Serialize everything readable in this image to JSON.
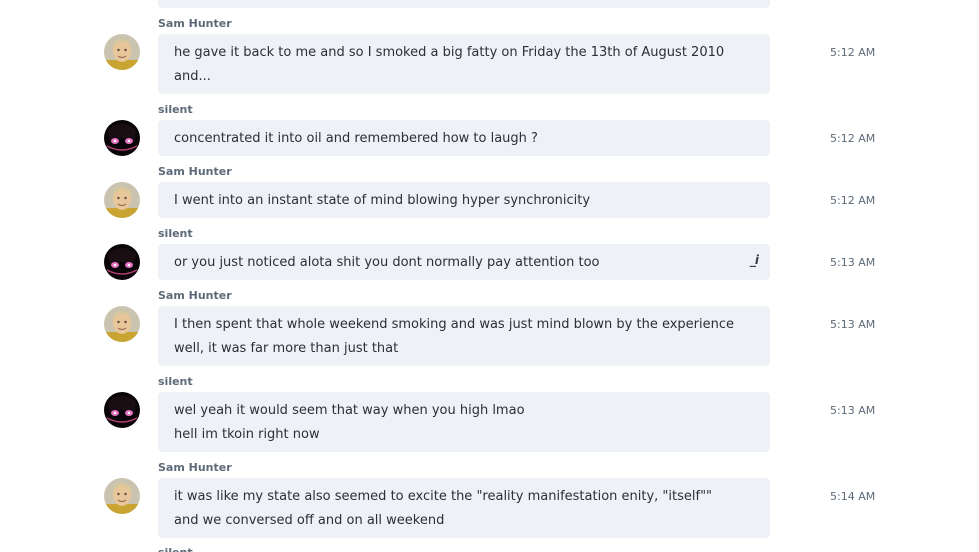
{
  "colors": {
    "bubble_bg": "#eef1f5",
    "sender_text": "#5d6a78",
    "message_text": "#2c2f33",
    "time_text": "#5d6a78"
  },
  "messages": [
    {
      "sender": "Sam Hunter",
      "avatar": "sam-avatar",
      "lines": [
        "he gave it back to me and so I smoked a big fatty on Friday the 13th of August 2010",
        "and..."
      ],
      "time": "5:12 AM"
    },
    {
      "sender": "silent",
      "avatar": "silent-avatar",
      "lines": [
        "concentrated it into oil and remembered how to laugh ?"
      ],
      "time": "5:12 AM"
    },
    {
      "sender": "Sam Hunter",
      "avatar": "sam-avatar",
      "lines": [
        "I went into an instant state of mind blowing hyper synchronicity"
      ],
      "time": "5:12 AM"
    },
    {
      "sender": "silent",
      "avatar": "silent-avatar",
      "lines": [
        "or you just noticed alota shit you dont normally pay attention too"
      ],
      "time": "5:13 AM",
      "edit_icon": "_i"
    },
    {
      "sender": "Sam Hunter",
      "avatar": "sam-avatar",
      "lines": [
        "I then spent that whole weekend smoking and was just mind blown by the experience",
        "well, it was far more than just that"
      ],
      "time": "5:13 AM"
    },
    {
      "sender": "silent",
      "avatar": "silent-avatar",
      "lines": [
        "wel yeah it would seem that way when you high lmao",
        "hell im tkoin right now"
      ],
      "time": "5:13 AM"
    },
    {
      "sender": "Sam Hunter",
      "avatar": "sam-avatar",
      "lines": [
        "it was like my state also seemed to excite the \"reality manifestation enity, \"itself\"\"",
        "and we conversed off and on all weekend"
      ],
      "time": "5:14 AM"
    }
  ],
  "next_sender_partial": "silent"
}
